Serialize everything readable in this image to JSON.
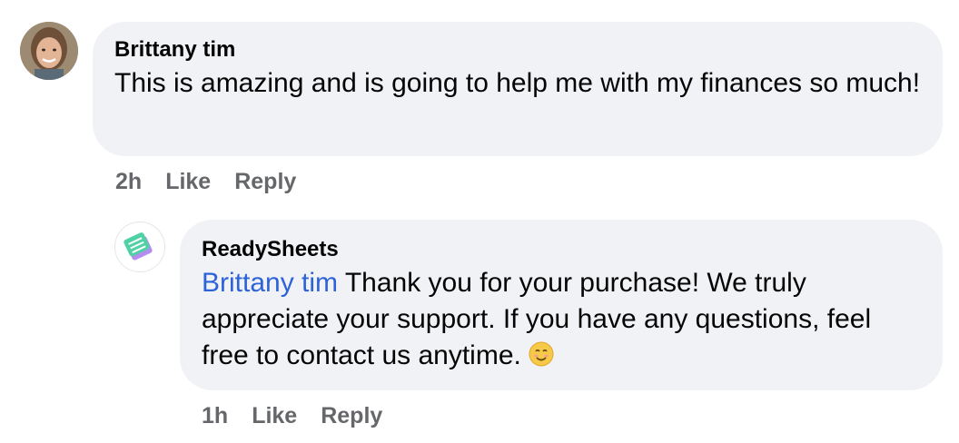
{
  "comment": {
    "author": "Brittany tim",
    "text": "This is amazing and is going to help me with my finances so much!",
    "time": "2h",
    "like_label": "Like",
    "reply_label": "Reply"
  },
  "reply": {
    "author": "ReadySheets",
    "mention": "Brittany tim",
    "text": " Thank you for your purchase! We truly appreciate your support. If you have any questions, feel free to contact us anytime.",
    "emoji": "smiling-face-icon",
    "time": "1h",
    "like_label": "Like",
    "reply_label": "Reply"
  },
  "colors": {
    "bubble": "#f0f2f5",
    "mention": "#2d63d8",
    "meta": "#65676b",
    "logo_green": "#4fd1a5",
    "logo_purple": "#b58cf0"
  }
}
